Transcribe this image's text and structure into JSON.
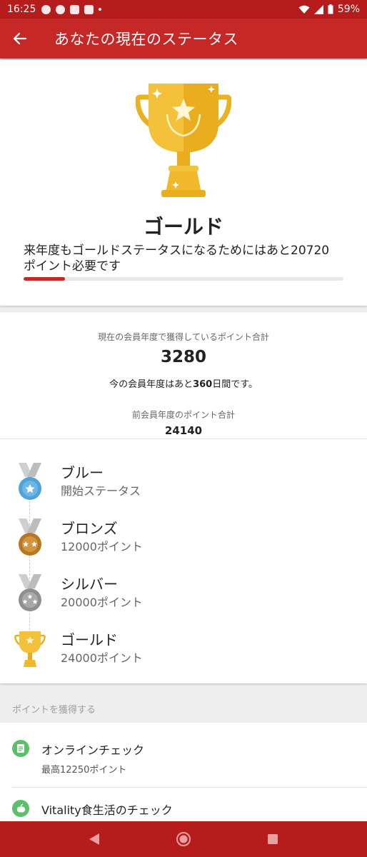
{
  "statusbar": {
    "time": "16:25",
    "battery": "59%"
  },
  "appbar": {
    "title": "あなたの現在のステータス"
  },
  "status": {
    "name": "ゴールド",
    "message": "来年度もゴールドステータスになるためにはあと20720 ポイント必要です",
    "progress": 0.13
  },
  "points": {
    "current_label": "現在の会員年度で獲得しているポイント合計",
    "current_value": "3280",
    "remain_prefix": "今の会員年度はあと",
    "remain_days": "360",
    "remain_suffix": "日間です。",
    "prev_label": "前会員年度のポイント合計",
    "prev_value": "24140"
  },
  "tiers": [
    {
      "name": "ブルー",
      "sub": "開始ステータス",
      "color": "#4fa3d9"
    },
    {
      "name": "ブロンズ",
      "sub": "12000ポイント",
      "color": "#c98a2e"
    },
    {
      "name": "シルバー",
      "sub": "20000ポイント",
      "color": "#9e9e9e"
    },
    {
      "name": "ゴールド",
      "sub": "24000ポイント",
      "color": "#f2b928"
    }
  ],
  "earn": {
    "header": "ポイントを獲得する",
    "items": [
      {
        "title": "オンラインチェック",
        "sub": "最高12250ポイント"
      },
      {
        "title": "Vitality食生活のチェック"
      }
    ]
  },
  "colors": {
    "brand": "#c62828",
    "gold": "#f2b928",
    "green": "#5cbf6b"
  }
}
